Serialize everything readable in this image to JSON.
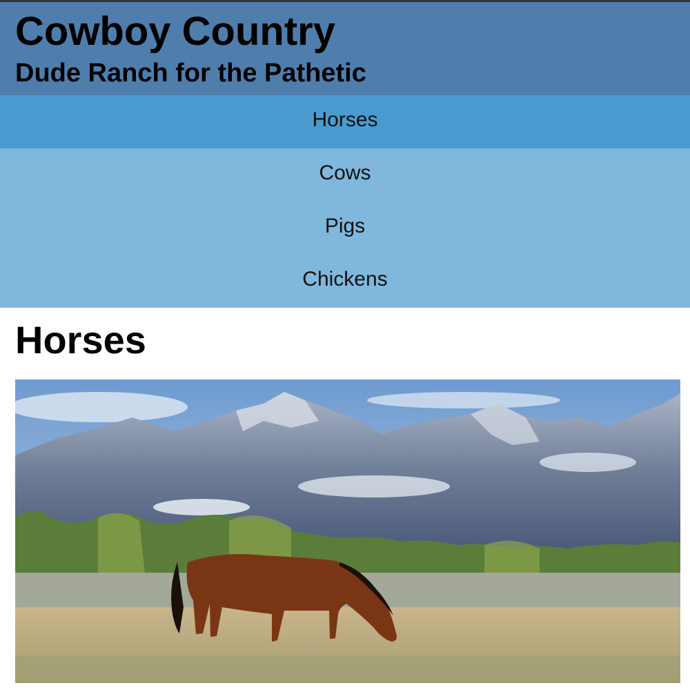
{
  "site": {
    "title": "Cowboy Country",
    "tagline": "Dude Ranch for the Pathetic"
  },
  "nav": {
    "items": [
      {
        "label": "Horses",
        "active": true
      },
      {
        "label": "Cows",
        "active": false
      },
      {
        "label": "Pigs",
        "active": false
      },
      {
        "label": "Chickens",
        "active": false
      }
    ]
  },
  "main": {
    "heading": "Horses",
    "image": {
      "subject": "horse-grazing-mountains-photo"
    }
  },
  "colors": {
    "header_bg": "#4f7ead",
    "nav_bg": "#80b7dc",
    "nav_active_bg": "#4a9bd0"
  }
}
